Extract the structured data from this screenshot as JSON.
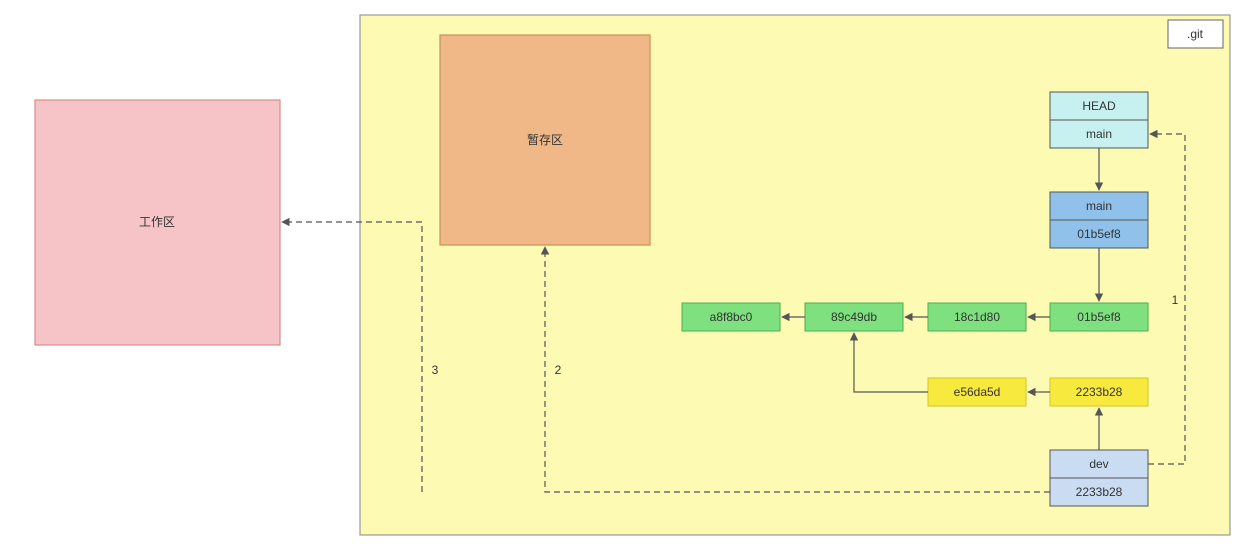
{
  "areas": {
    "working": {
      "label": "工作区"
    },
    "staging": {
      "label": "暂存区"
    },
    "git": {
      "label": ".git"
    }
  },
  "head": {
    "title": "HEAD",
    "ref": "main"
  },
  "branches": {
    "main": {
      "name": "main",
      "commit": "01b5ef8"
    },
    "dev": {
      "name": "dev",
      "commit": "2233b28"
    }
  },
  "commits": {
    "main_chain": [
      "a8f8bc0",
      "89c49db",
      "18c1d80",
      "01b5ef8"
    ],
    "dev_chain": [
      "e56da5d",
      "2233b28"
    ]
  },
  "steps": {
    "s1": "1",
    "s2": "2",
    "s3": "3"
  },
  "colors": {
    "working_fill": "#f6c4c6",
    "working_stroke": "#d98b8e",
    "staging_fill": "#f0b887",
    "staging_stroke": "#c98f58",
    "git_fill": "#fdfab3",
    "git_stroke": "#999999",
    "head_fill": "#c7f0f0",
    "head_stroke": "#555555",
    "main_fill": "#8fc1eb",
    "main_stroke": "#555555",
    "commit_fill": "#7ee07e",
    "commit_stroke": "#4caf50",
    "dev_commit_fill": "#f7e93e",
    "dev_commit_stroke": "#d4c726",
    "dev_ref_fill": "#c9dcf2",
    "dev_ref_stroke": "#555555"
  }
}
